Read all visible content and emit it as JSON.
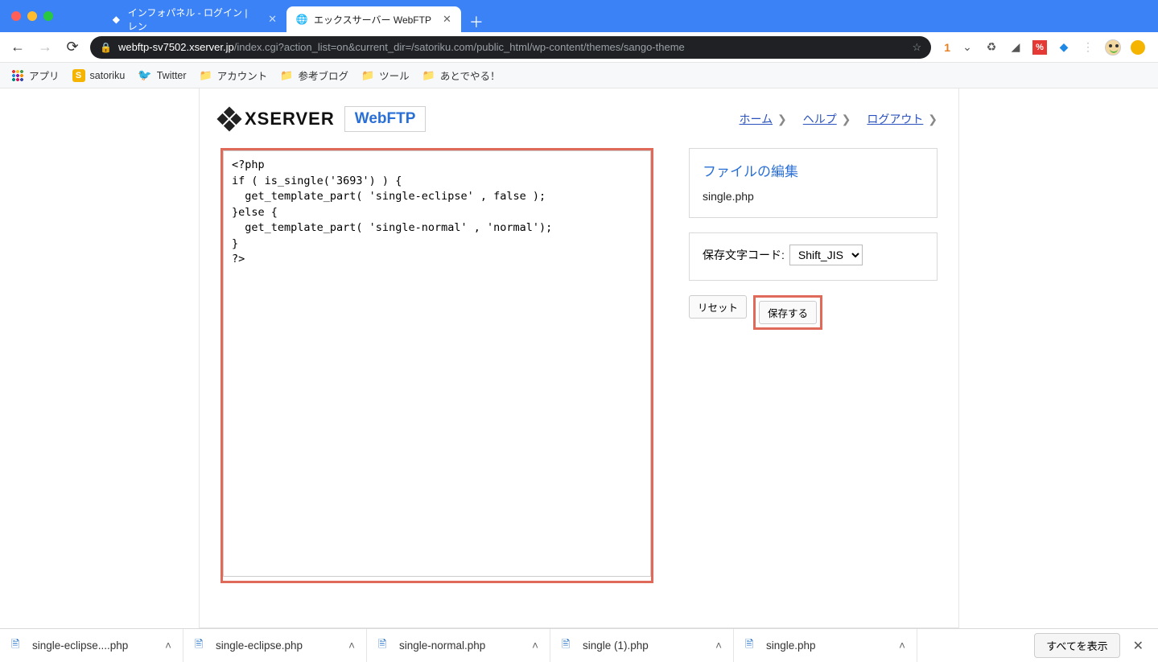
{
  "browser": {
    "tabs": [
      {
        "title": "インフォパネル - ログイン | レン",
        "active": false
      },
      {
        "title": "エックスサーバー WebFTP",
        "active": true
      }
    ],
    "url_host": "webftp-sv7502.xserver.jp",
    "url_path": "/index.cgi?action_list=on&current_dir=/satoriku.com/public_html/wp-content/themes/sango-theme",
    "badge_count": "1"
  },
  "bookmarks": {
    "apps": "アプリ",
    "items": [
      "satoriku",
      "Twitter",
      "アカウント",
      "参考ブログ",
      "ツール",
      "あとでやる！"
    ]
  },
  "header": {
    "brand": "XSERVER",
    "product": "WebFTP",
    "links": {
      "home": "ホーム",
      "help": "ヘルプ",
      "logout": "ログアウト"
    }
  },
  "editor": {
    "code": "<?php\nif ( is_single('3693') ) {\n  get_template_part( 'single-eclipse' , false );\n}else {\n  get_template_part( 'single-normal' , 'normal');\n}\n?>"
  },
  "sidebar": {
    "edit_title": "ファイルの編集",
    "filename": "single.php",
    "encoding_label": "保存文字コード:",
    "encoding_value": "Shift_JIS",
    "reset_label": "リセット",
    "save_label": "保存する"
  },
  "downloads": {
    "items": [
      "single-eclipse....php",
      "single-eclipse.php",
      "single-normal.php",
      "single (1).php",
      "single.php"
    ],
    "show_all": "すべてを表示"
  }
}
